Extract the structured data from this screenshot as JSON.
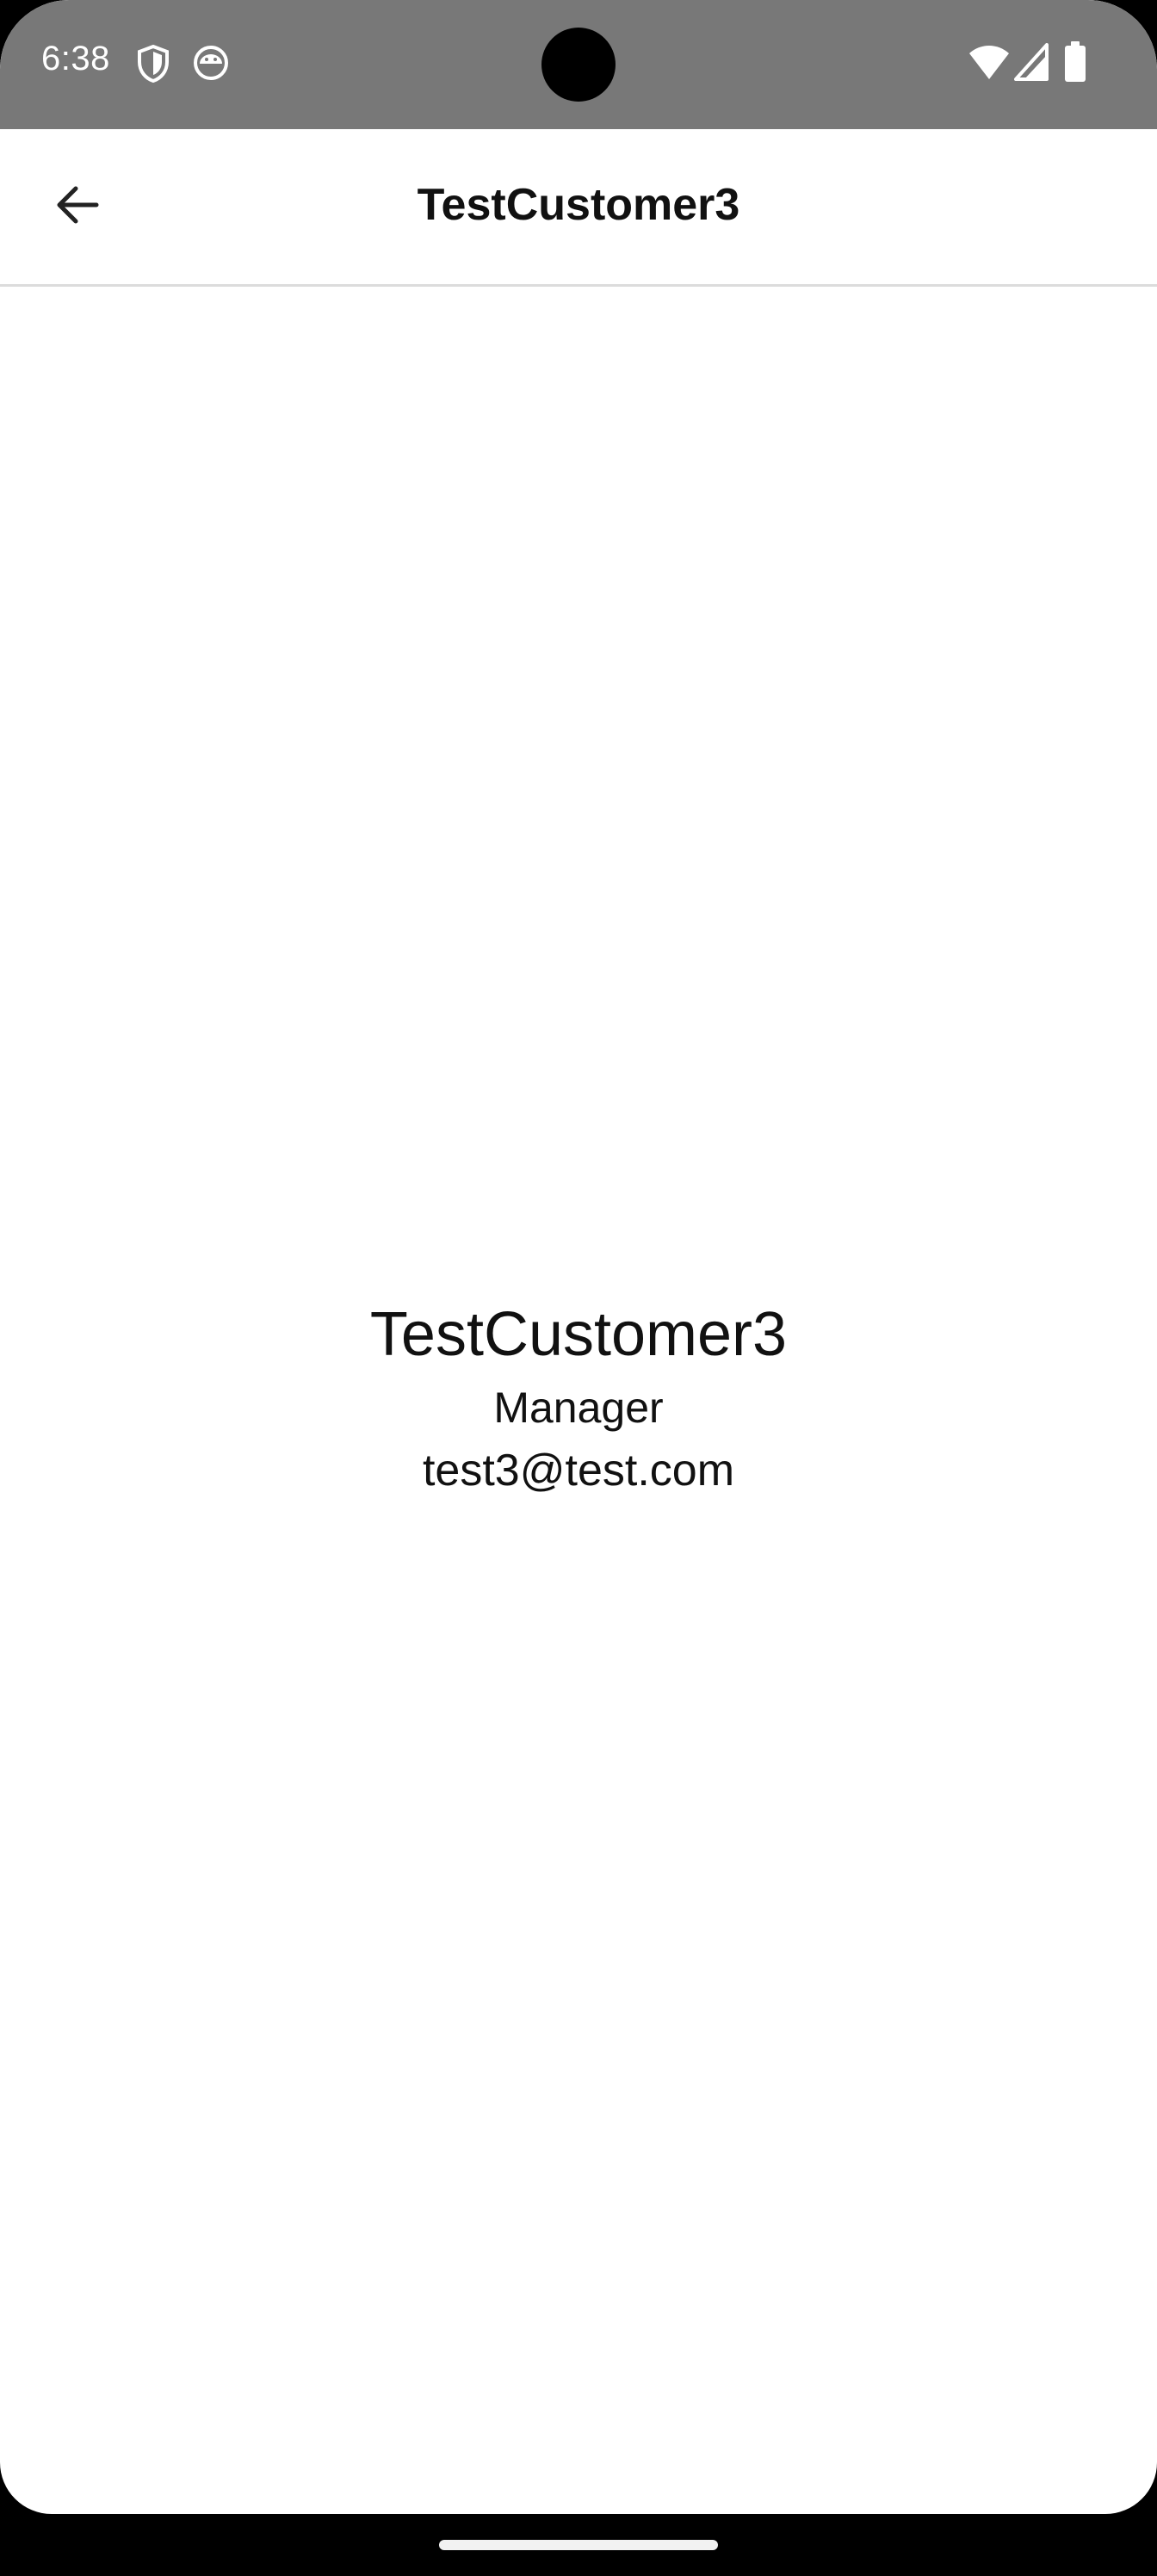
{
  "status_bar": {
    "time": "6:38",
    "icons_left": [
      "shield-icon",
      "android-robot-icon"
    ],
    "icons_right": [
      "wifi-icon",
      "signal-icon",
      "battery-icon"
    ],
    "background": "#787878"
  },
  "app_bar": {
    "back_icon": "arrow-left-icon",
    "title": "TestCustomer3"
  },
  "profile": {
    "name": "TestCustomer3",
    "role": "Manager",
    "email": "test3@test.com"
  }
}
